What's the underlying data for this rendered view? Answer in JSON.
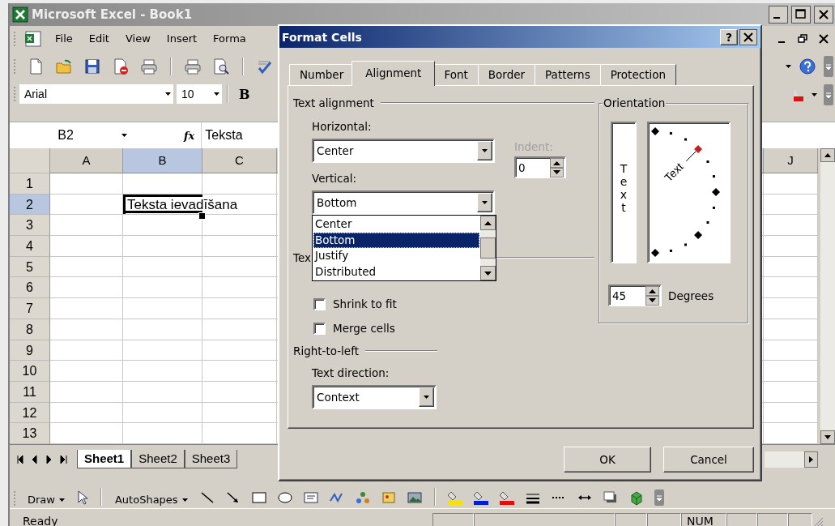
{
  "excel": {
    "title": "Microsoft Excel - Book1",
    "menu": [
      "File",
      "Edit",
      "View",
      "Insert",
      "Forma"
    ],
    "font_name": "Arial",
    "font_size": "10",
    "bold_button": "B",
    "name_box": "B2",
    "function_label": "fx",
    "formula": "Teksta",
    "columns": [
      {
        "label": "A",
        "selected": false
      },
      {
        "label": "B",
        "selected": true
      },
      {
        "label": "C",
        "selected": false
      },
      {
        "label": "J",
        "selected": false
      }
    ],
    "rows": [
      {
        "label": "1",
        "selected": false
      },
      {
        "label": "2",
        "selected": true
      },
      {
        "label": "3",
        "selected": false
      },
      {
        "label": "4",
        "selected": false
      },
      {
        "label": "5",
        "selected": false
      },
      {
        "label": "6",
        "selected": false
      },
      {
        "label": "7",
        "selected": false
      },
      {
        "label": "8",
        "selected": false
      },
      {
        "label": "9",
        "selected": false
      },
      {
        "label": "10",
        "selected": false
      },
      {
        "label": "11",
        "selected": false
      },
      {
        "label": "12",
        "selected": false
      },
      {
        "label": "13",
        "selected": false
      }
    ],
    "active_cell": {
      "text": "Teksta ievadīšana"
    },
    "sheets": [
      {
        "label": "Sheet1",
        "selected": true
      },
      {
        "label": "Sheet2",
        "selected": false
      },
      {
        "label": "Sheet3",
        "selected": false
      }
    ],
    "drawing_toolbar": {
      "draw": "Draw",
      "autoshapes": "AutoShapes"
    },
    "status_bar": {
      "text": "Ready",
      "indicator": "NUM"
    }
  },
  "dialog": {
    "title": "Format Cells",
    "help": "?",
    "tabs": [
      {
        "label": "Number",
        "selected": false
      },
      {
        "label": "Alignment",
        "selected": true
      },
      {
        "label": "Font",
        "selected": false
      },
      {
        "label": "Border",
        "selected": false
      },
      {
        "label": "Patterns",
        "selected": false
      },
      {
        "label": "Protection",
        "selected": false
      }
    ],
    "text_alignment": {
      "label": "Text alignment",
      "horizontal": {
        "label": "Horizontal:",
        "value": "Center"
      },
      "indent": {
        "label": "Indent:",
        "value": "0",
        "disabled": true
      },
      "vertical": {
        "label": "Vertical:",
        "value": "Bottom",
        "options": [
          {
            "label": "Center",
            "selected": false
          },
          {
            "label": "Bottom",
            "selected": true
          },
          {
            "label": "Justify",
            "selected": false
          },
          {
            "label": "Distributed",
            "selected": false
          }
        ]
      }
    },
    "text_control": {
      "label": "Tex",
      "checkboxes": [
        {
          "label": "Shrink to fit",
          "checked": false
        },
        {
          "label": "Merge cells",
          "checked": false
        }
      ]
    },
    "right_to_left": {
      "label": "Right-to-left",
      "text_direction": {
        "label": "Text direction:",
        "value": "Context"
      }
    },
    "orientation": {
      "label": "Orientation",
      "vertical_text": "Text",
      "dial_text": "Text",
      "degrees": {
        "value": "45",
        "label": "Degrees"
      }
    },
    "buttons": [
      "OK",
      "Cancel"
    ]
  }
}
